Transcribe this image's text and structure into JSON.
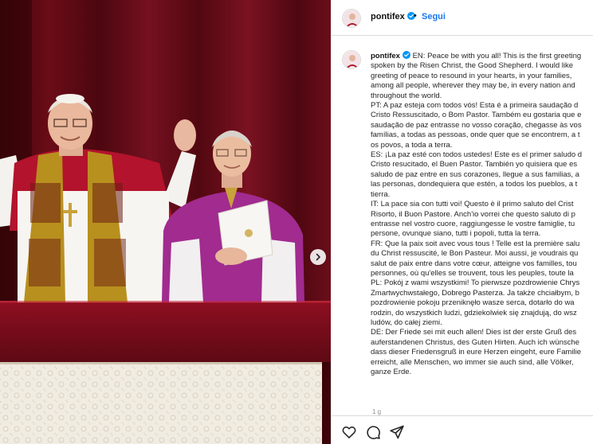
{
  "post": {
    "username": "pontifex",
    "follow_label": "Segui",
    "separator": "•",
    "age": "1 g",
    "verified_color": "#0095f6",
    "link_color": "#1877f2"
  },
  "caption": {
    "username": "pontifex",
    "lines": [
      "EN: Peace be with you all! This is the first greeting",
      "spoken by the Risen Christ, the Good Shepherd. I would like",
      "greeting of peace to resound in your hearts, in your families,",
      "among all people, wherever they may be, in every nation and",
      "throughout the world.",
      "PT: A paz esteja com todos vós! Esta é a primeira saudação d",
      "Cristo Ressuscitado, o Bom Pastor. Também eu gostaria que e",
      "saudação de paz entrasse no vosso coração, chegasse às vos",
      "famílias, a todas as pessoas, onde quer que se encontrem, a t",
      "os povos, a toda a terra.",
      "ES: ¡La paz esté con todos ustedes! Este es el primer saludo d",
      "Cristo resucitado, el Buen Pastor. También yo quisiera que es",
      "saludo de paz entre en sus corazones, llegue a sus familias, a",
      "las personas, dondequiera que estén, a todos los pueblos, a t",
      "tierra.",
      "IT: La pace sia con tutti voi! Questo è il primo saluto del Crist",
      "Risorto, il Buon Pastore. Anch'io vorrei che questo saluto di p",
      "entrasse nel vostro cuore, raggiungesse le vostre famiglie, tu",
      "persone, ovunque siano, tutti i popoli, tutta la terra.",
      "FR: Que la paix soit avec vous tous ! Telle est la première salu",
      "du Christ ressuscité, le Bon Pasteur. Moi aussi, je voudrais qu",
      "salut de paix entre dans votre cœur, atteigne vos familles, tou",
      "personnes, où qu'elles se trouvent, tous les peuples, toute la",
      "PL: Pokój z wami wszystkimi! To pierwsze pozdrowienie Chrys",
      "Zmartwychwstałego, Dobrego Pasterza. Ja także chciałbym, b",
      "pozdrowienie pokoju przeniknęło wasze serca, dotarło do wa",
      "rodzin, do wszystkich ludzi, gdziekolwiek się znajdują, do wsz",
      "ludów, do całej ziemi.",
      "DE: Der Friede sei mit euch allen! Dies ist der erste Gruß des",
      "auferstandenen Christus, des Guten Hirten. Auch ich wünsche",
      "dass dieser Friedensgruß in eure Herzen eingeht, eure Familie",
      "erreicht, alle Menschen, wo immer sie auch sind, alle Völker,",
      "ganze Erde."
    ]
  },
  "icons": {
    "like": "heart-icon",
    "comment": "comment-icon",
    "share": "share-icon",
    "next": "chevron-right-icon",
    "verified": "verified-badge-icon"
  }
}
